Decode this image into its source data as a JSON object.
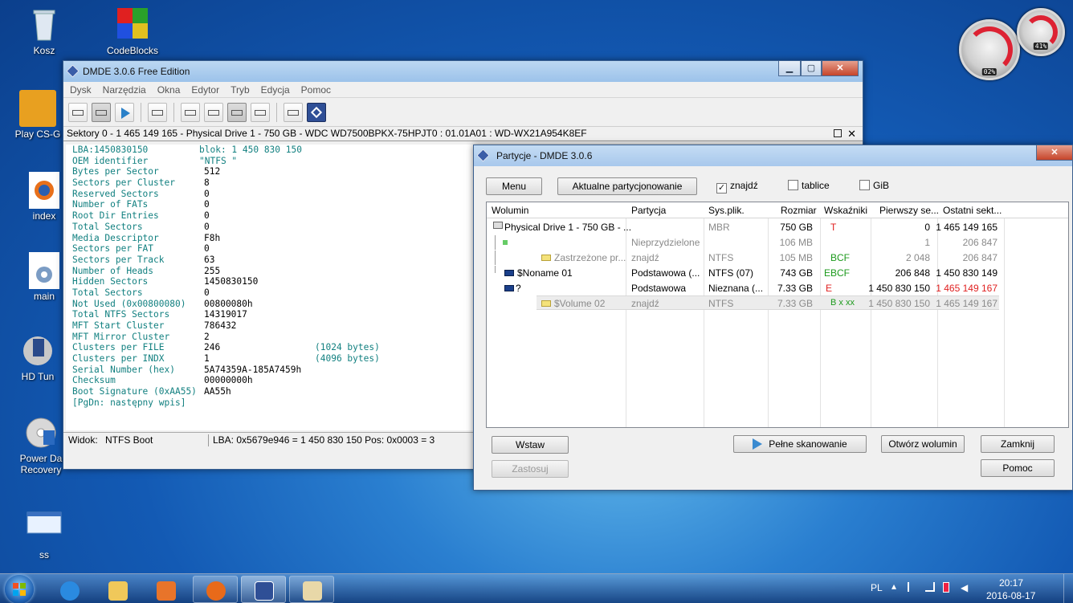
{
  "desktop": {
    "icons": [
      {
        "label": "Kosz",
        "icon": "recycle-bin-icon"
      },
      {
        "label": "CodeBlocks",
        "icon": "codeblocks-icon"
      },
      {
        "label": "Play CS-G",
        "icon": "csgo-icon"
      },
      {
        "label": "index",
        "icon": "firefox-file-icon"
      },
      {
        "label": "main",
        "icon": "settings-file-icon"
      },
      {
        "label": "HD Tun",
        "icon": "hdtune-icon"
      },
      {
        "label": "Power Da Recovery",
        "icon": "power-data-recovery-icon"
      },
      {
        "label": "ss",
        "icon": "screenshot-file-icon"
      }
    ],
    "gadget": {
      "cpu": "02%",
      "ram": "41%"
    }
  },
  "dmde": {
    "title": "DMDE 3.0.6 Free Edition",
    "window_buttons": {
      "minimize": "▁",
      "maximize": "▢",
      "close": "✕"
    },
    "menu": [
      "Dysk",
      "Narzędzia",
      "Okna",
      "Edytor",
      "Tryb",
      "Edycja",
      "Pomoc"
    ],
    "sectors_bar": "Sektory 0 - 1 465 149 165 - Physical Drive 1 - 750 GB - WDC WD7500BPKX-75HPJT0 : 01.01A01 : WD-WX21A954K8EF",
    "hex_header": {
      "lba": "LBA:1450830150",
      "block": "blok: 1 450 830 150"
    },
    "rows": [
      {
        "k": "OEM identifier",
        "v": "\"NTFS    \"",
        "n": ""
      },
      {
        "k": "Bytes per Sector",
        "v": "512",
        "n": ""
      },
      {
        "k": "Sectors per Cluster",
        "v": "8",
        "n": ""
      },
      {
        "k": "Reserved Sectors",
        "v": "0",
        "n": ""
      },
      {
        "k": "Number of FATs",
        "v": "0",
        "n": ""
      },
      {
        "k": "Root Dir Entries",
        "v": "0",
        "n": ""
      },
      {
        "k": "Total Sectors",
        "v": "0",
        "n": ""
      },
      {
        "k": "Media Descriptor",
        "v": "F8h",
        "n": ""
      },
      {
        "k": "Sectors per FAT",
        "v": "0",
        "n": ""
      },
      {
        "k": "Sectors per Track",
        "v": "63",
        "n": ""
      },
      {
        "k": "Number of Heads",
        "v": "255",
        "n": ""
      },
      {
        "k": "Hidden Sectors",
        "v": "1450830150",
        "n": ""
      },
      {
        "k": "Total Sectors",
        "v": "0",
        "n": ""
      },
      {
        "k": "Not Used (0x00800080)",
        "v": "00800080h",
        "n": ""
      },
      {
        "k": "Total NTFS Sectors",
        "v": "14319017",
        "n": ""
      },
      {
        "k": "MFT Start Cluster",
        "v": "786432",
        "n": ""
      },
      {
        "k": "MFT Mirror Cluster",
        "v": "2",
        "n": ""
      },
      {
        "k": "Clusters per FILE",
        "v": "246",
        "n": "(1024 bytes)"
      },
      {
        "k": "Clusters per INDX",
        "v": "1",
        "n": "(4096 bytes)"
      },
      {
        "k": "Serial Number (hex)",
        "v": "5A74359A-185A7459h",
        "n": ""
      },
      {
        "k": "Checksum",
        "v": "00000000h",
        "n": ""
      },
      {
        "k": "Boot Signature (0xAA55)",
        "v": "AA55h",
        "n": ""
      }
    ],
    "footer_hint": "[PgDn: następny wpis]",
    "status": {
      "view_label": "Widok:",
      "view_value": "NTFS Boot",
      "lba": "LBA: 0x5679e946 = 1 450 830 150  Pos: 0x0003 = 3"
    }
  },
  "partitions": {
    "title": "Partycje - DMDE 3.0.6",
    "menu_button": "Menu",
    "current_button": "Aktualne partycjonowanie",
    "checkboxes": [
      {
        "label": "znajdź",
        "checked": true
      },
      {
        "label": "tablice",
        "checked": false
      },
      {
        "label": "GiB",
        "checked": false
      }
    ],
    "columns": [
      "Wolumin",
      "Partycja",
      "Sys.plik.",
      "Rozmiar",
      "Wskaźniki",
      "Pierwszy se...",
      "Ostatni sekt..."
    ],
    "rows": [
      {
        "name": "Physical Drive 1 - 750 GB - ...",
        "part": "",
        "fs": "MBR",
        "size": "750 GB",
        "flags": "T",
        "first": "0",
        "last": "1 465 149 165"
      },
      {
        "name": "",
        "part": "Nieprzydzielone",
        "fs": "",
        "size": "106 MB",
        "flags": "",
        "first": "1",
        "last": "206 847"
      },
      {
        "name": "Zastrzeżone pr...",
        "part": "znajdź",
        "fs": "NTFS",
        "size": "105 MB",
        "flags": "BCF",
        "first": "2 048",
        "last": "206 847"
      },
      {
        "name": "$Noname 01",
        "part": "Podstawowa (...",
        "fs": "NTFS (07)",
        "size": "743 GB",
        "flags": "EBCF",
        "first": "206 848",
        "last": "1 450 830 149"
      },
      {
        "name": "?",
        "part": "Podstawowa",
        "fs": "Nieznana (...",
        "size": "7.33 GB",
        "flags": "E",
        "first": "1 450 830 150",
        "last": "1 465 149 167"
      },
      {
        "name": "$Volume 02",
        "part": "znajdź",
        "fs": "NTFS",
        "size": "7.33 GB",
        "flags": "B x xx",
        "first": "1 450 830 150",
        "last": "1 465 149 167"
      }
    ],
    "buttons": {
      "insert": "Wstaw",
      "apply": "Zastosuj",
      "full_scan": "Pełne skanowanie",
      "open_volume": "Otwórz wolumin",
      "close": "Zamknij",
      "help": "Pomoc"
    },
    "close_glyph": "✕"
  },
  "taskbar": {
    "apps": [
      "internet-explorer-icon",
      "file-explorer-icon",
      "media-player-icon",
      "firefox-icon",
      "dmde-icon",
      "paint-icon"
    ],
    "lang": "PL",
    "time": "20:17",
    "date": "2016-08-17"
  }
}
